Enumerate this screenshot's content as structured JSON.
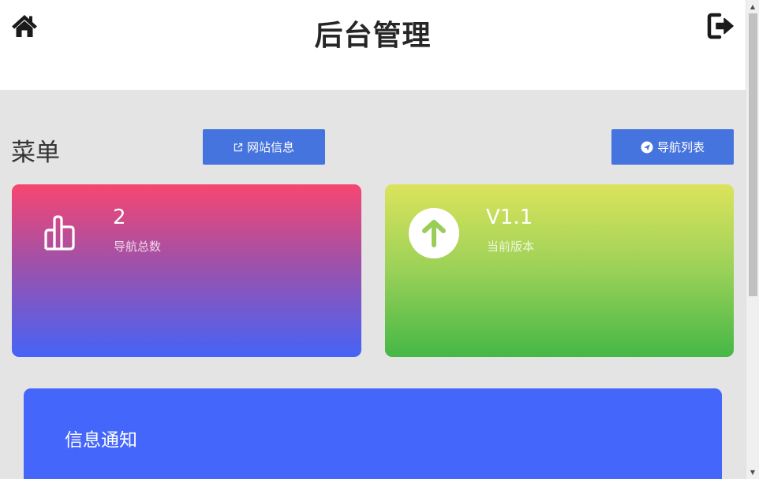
{
  "header": {
    "title": "后台管理",
    "home_icon": "home-icon",
    "logout_icon": "logout-icon"
  },
  "menu": {
    "title": "菜单",
    "site_info_button": "网站信息",
    "nav_list_button": "导航列表"
  },
  "cards": [
    {
      "value": "2",
      "label": "导航总数",
      "icon": "thumbs-up-icon"
    },
    {
      "value": "V1.1",
      "label": "当前版本",
      "icon": "arrow-up-icon"
    }
  ],
  "notice": {
    "title": "信息通知"
  },
  "colors": {
    "button": "#4674de",
    "notice": "#4466fb",
    "card_nav_top": "#f74671",
    "card_nav_bottom": "#4563f7",
    "card_ver_top": "#dce35c",
    "card_ver_bottom": "#45b746"
  }
}
